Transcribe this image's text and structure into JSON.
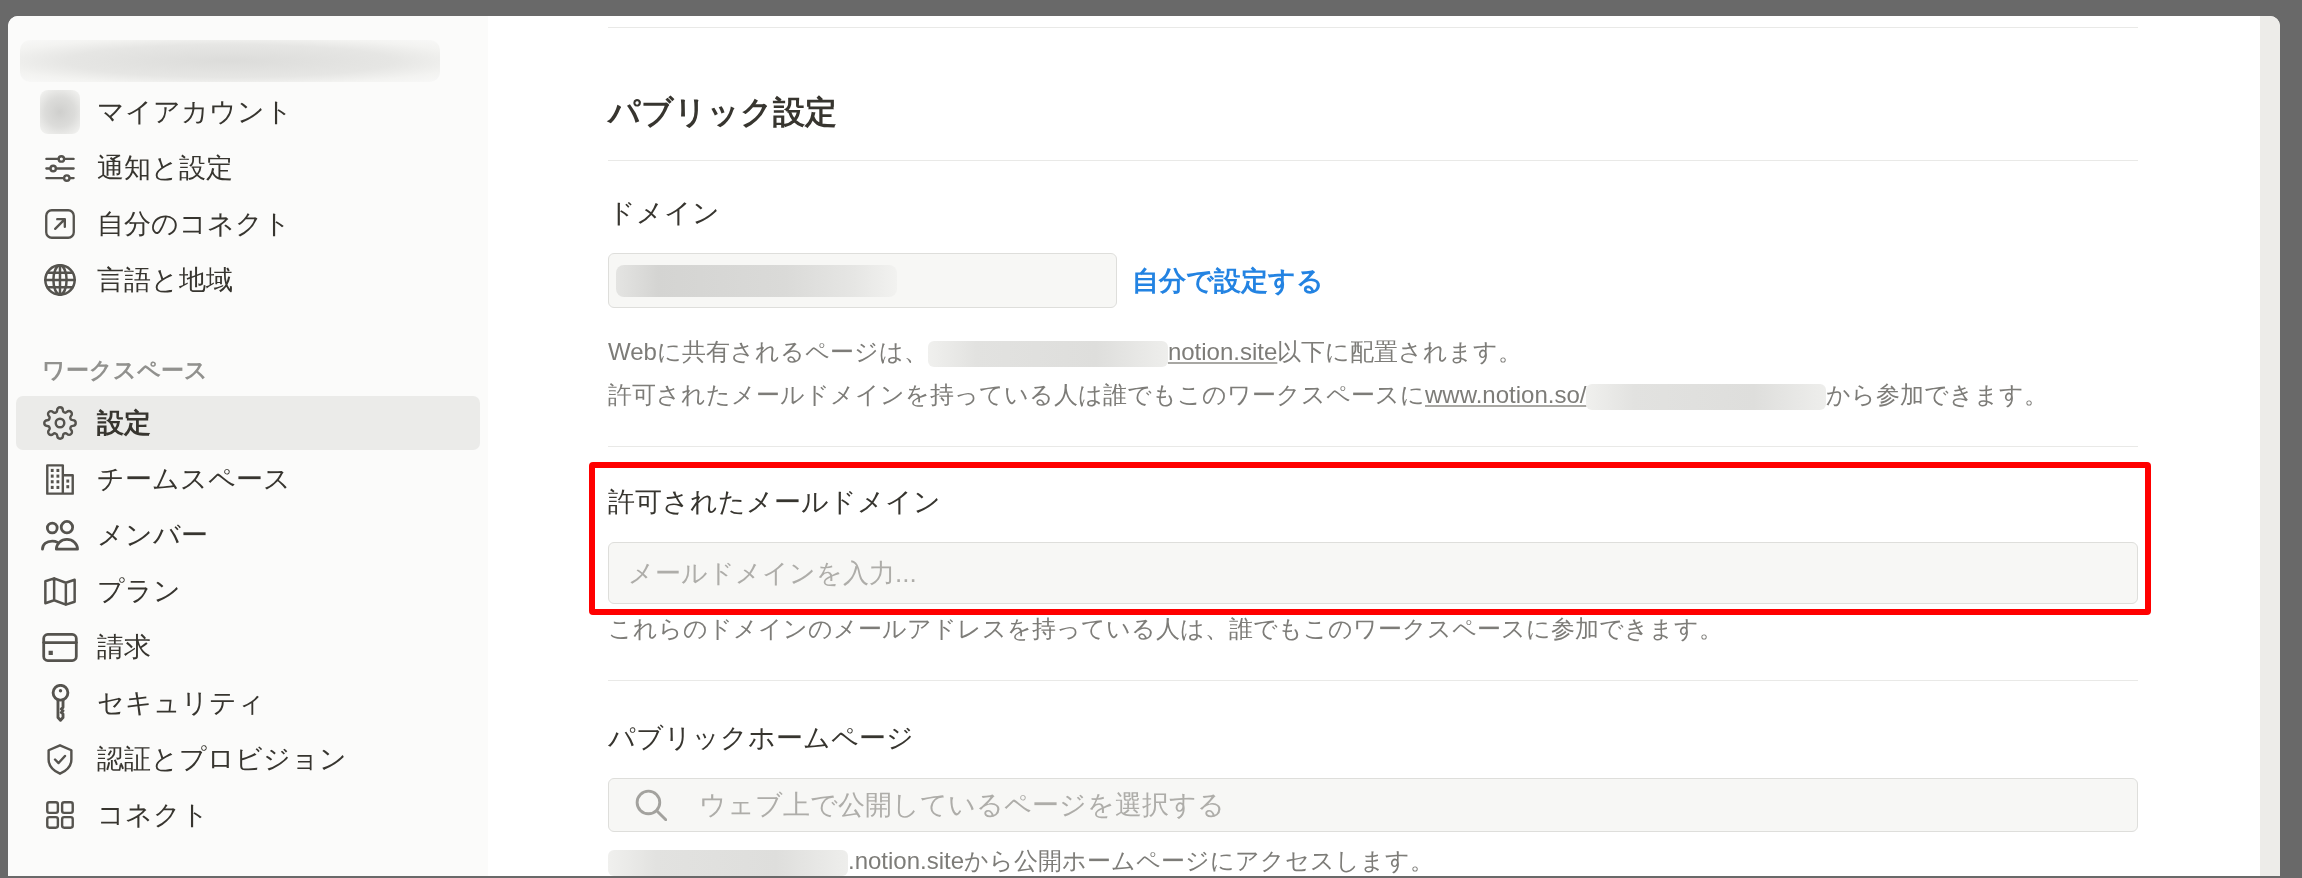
{
  "sidebar": {
    "account_items": [
      {
        "label": "マイアカウント",
        "selected": false
      },
      {
        "label": "通知と設定",
        "selected": false
      },
      {
        "label": "自分のコネクト",
        "selected": false
      },
      {
        "label": "言語と地域",
        "selected": false
      }
    ],
    "workspace_heading": "ワークスペース",
    "workspace_items": [
      {
        "label": "設定",
        "selected": true
      },
      {
        "label": "チームスペース",
        "selected": false
      },
      {
        "label": "メンバー",
        "selected": false
      },
      {
        "label": "プラン",
        "selected": false
      },
      {
        "label": "請求",
        "selected": false
      },
      {
        "label": "セキュリティ",
        "selected": false
      },
      {
        "label": "認証とプロビジョン",
        "selected": false
      },
      {
        "label": "コネクト",
        "selected": false
      }
    ]
  },
  "main": {
    "title": "パブリック設定",
    "sections": [
      {
        "kind": "domain",
        "label": "ドメイン",
        "highlighted": false,
        "field": {
          "redacted": true
        },
        "link": "自分で設定する",
        "notes": [
          [
            {
              "kind": "text",
              "text": "Webに共有されるページは、"
            },
            {
              "kind": "redacted"
            },
            {
              "kind": "link",
              "text": "notion.site"
            },
            {
              "kind": "text",
              "text": "以下に配置されます。"
            }
          ],
          [
            {
              "kind": "text",
              "text": "許可されたメールドメインを持っている人は誰でもこのワークスペースに"
            },
            {
              "kind": "link",
              "text": "www.notion.so/"
            },
            {
              "kind": "redacted"
            },
            {
              "kind": "text",
              "text": "から参加できます。"
            }
          ]
        ]
      },
      {
        "kind": "input",
        "label": "許可されたメールドメイン",
        "highlighted": true,
        "placeholder": "メールドメインを入力...",
        "notes": [
          [
            {
              "kind": "text",
              "text": "これらのドメインのメールアドレスを持っている人は、誰でもこのワークスペースに参加できます。"
            }
          ]
        ]
      },
      {
        "kind": "search",
        "label": "パブリックホームページ",
        "highlighted": false,
        "placeholder": "ウェブ上で公開しているページを選択する",
        "notes": [
          [
            {
              "kind": "redacted"
            },
            {
              "kind": "text",
              "text": ".notion.siteから公開ホームページにアクセスします。"
            }
          ]
        ]
      }
    ]
  }
}
